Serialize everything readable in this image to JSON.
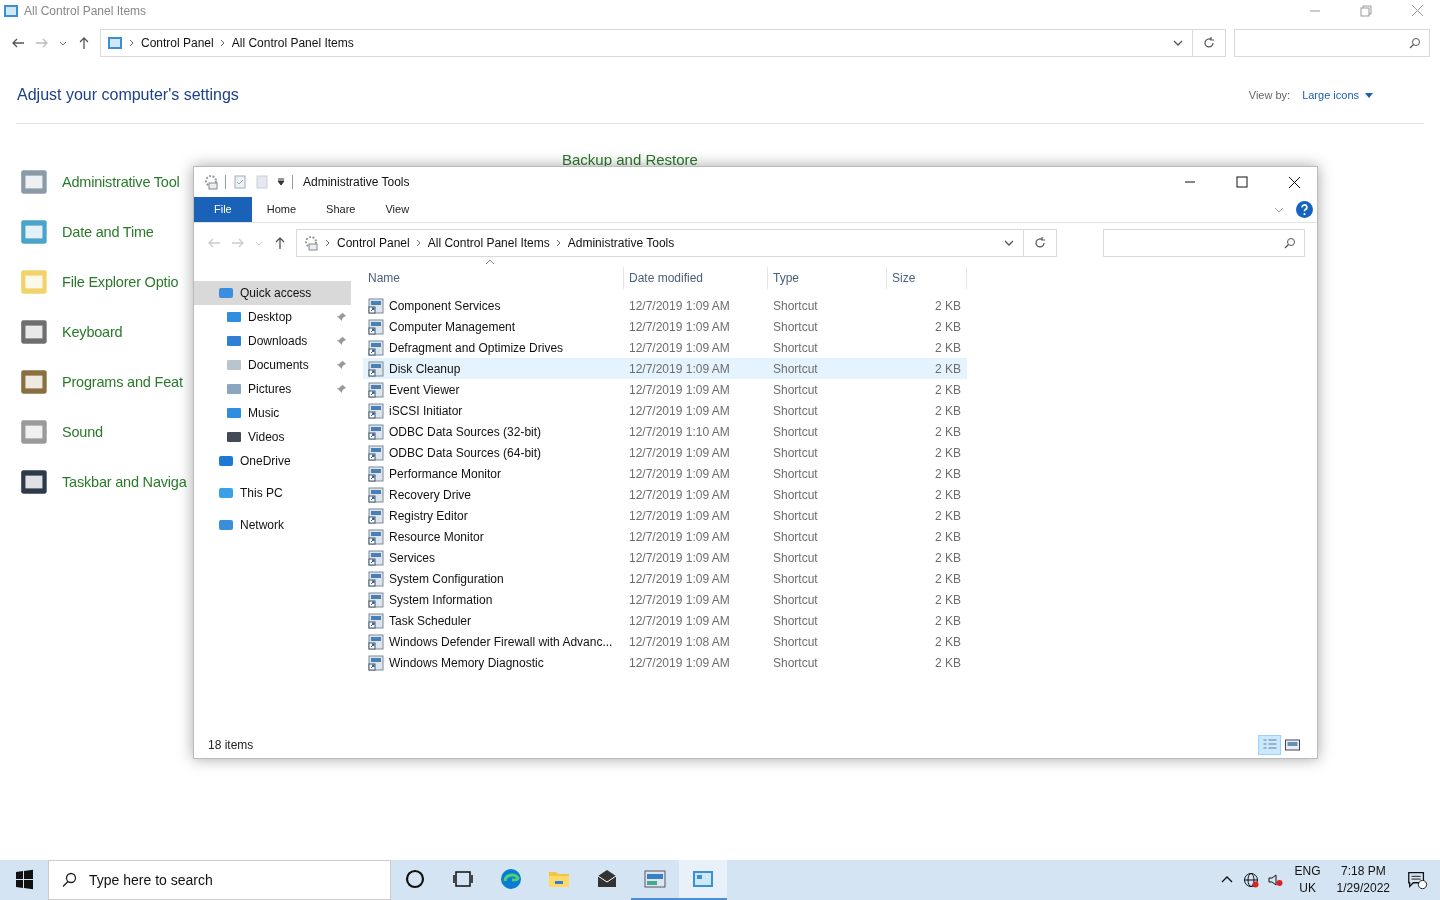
{
  "control_panel": {
    "title": "All Control Panel Items",
    "breadcrumb": [
      "Control Panel",
      "All Control Panel Items"
    ],
    "heading": "Adjust your computer's settings",
    "view_by": {
      "label": "View by:",
      "value": "Large icons"
    },
    "items": [
      {
        "label": "Administrative Tool",
        "kind": "admin"
      },
      {
        "label": "Date and Time",
        "kind": "clock"
      },
      {
        "label": "File Explorer Optio",
        "kind": "folder"
      },
      {
        "label": "Keyboard",
        "kind": "keyboard"
      },
      {
        "label": "Programs and Feat",
        "kind": "programs"
      },
      {
        "label": "Sound",
        "kind": "sound"
      },
      {
        "label": "Taskbar and Naviga",
        "kind": "taskbar"
      }
    ],
    "partial_item": "Backup and Restore"
  },
  "explorer": {
    "title": "Administrative Tools",
    "ribbon_tabs": [
      {
        "label": "File",
        "kind": "file"
      },
      {
        "label": "Home",
        "kind": "tab"
      },
      {
        "label": "Share",
        "kind": "tab"
      },
      {
        "label": "View",
        "kind": "tab"
      }
    ],
    "breadcrumb": [
      "Control Panel",
      "All Control Panel Items",
      "Administrative Tools"
    ],
    "nav": [
      {
        "label": "Quick access",
        "kind": "star",
        "selected": true,
        "children": [
          {
            "label": "Desktop",
            "kind": "desktop",
            "pinned": true,
            "selected": false
          },
          {
            "label": "Downloads",
            "kind": "download",
            "pinned": true,
            "selected": false
          },
          {
            "label": "Documents",
            "kind": "document",
            "pinned": true,
            "selected": false
          },
          {
            "label": "Pictures",
            "kind": "pictures",
            "pinned": true,
            "selected": false
          },
          {
            "label": "Music",
            "kind": "music",
            "pinned": false,
            "selected": false
          },
          {
            "label": "Videos",
            "kind": "videos",
            "pinned": false,
            "selected": false
          }
        ]
      },
      {
        "label": "OneDrive",
        "kind": "cloud",
        "selected": false
      },
      {
        "label": "This PC",
        "kind": "pc",
        "selected": false
      },
      {
        "label": "Network",
        "kind": "network",
        "selected": false
      }
    ],
    "columns": [
      "Name",
      "Date modified",
      "Type",
      "Size"
    ],
    "rows": [
      {
        "name": "Component Services",
        "date": "12/7/2019 1:09 AM",
        "type": "Shortcut",
        "size": "2 KB",
        "selected": false
      },
      {
        "name": "Computer Management",
        "date": "12/7/2019 1:09 AM",
        "type": "Shortcut",
        "size": "2 KB",
        "selected": false
      },
      {
        "name": "Defragment and Optimize Drives",
        "date": "12/7/2019 1:09 AM",
        "type": "Shortcut",
        "size": "2 KB",
        "selected": false
      },
      {
        "name": "Disk Cleanup",
        "date": "12/7/2019 1:09 AM",
        "type": "Shortcut",
        "size": "2 KB",
        "selected": true
      },
      {
        "name": "Event Viewer",
        "date": "12/7/2019 1:09 AM",
        "type": "Shortcut",
        "size": "2 KB",
        "selected": false
      },
      {
        "name": "iSCSI Initiator",
        "date": "12/7/2019 1:09 AM",
        "type": "Shortcut",
        "size": "2 KB",
        "selected": false
      },
      {
        "name": "ODBC Data Sources (32-bit)",
        "date": "12/7/2019 1:10 AM",
        "type": "Shortcut",
        "size": "2 KB",
        "selected": false
      },
      {
        "name": "ODBC Data Sources (64-bit)",
        "date": "12/7/2019 1:09 AM",
        "type": "Shortcut",
        "size": "2 KB",
        "selected": false
      },
      {
        "name": "Performance Monitor",
        "date": "12/7/2019 1:09 AM",
        "type": "Shortcut",
        "size": "2 KB",
        "selected": false
      },
      {
        "name": "Recovery Drive",
        "date": "12/7/2019 1:09 AM",
        "type": "Shortcut",
        "size": "2 KB",
        "selected": false
      },
      {
        "name": "Registry Editor",
        "date": "12/7/2019 1:09 AM",
        "type": "Shortcut",
        "size": "2 KB",
        "selected": false
      },
      {
        "name": "Resource Monitor",
        "date": "12/7/2019 1:09 AM",
        "type": "Shortcut",
        "size": "2 KB",
        "selected": false
      },
      {
        "name": "Services",
        "date": "12/7/2019 1:09 AM",
        "type": "Shortcut",
        "size": "2 KB",
        "selected": false
      },
      {
        "name": "System Configuration",
        "date": "12/7/2019 1:09 AM",
        "type": "Shortcut",
        "size": "2 KB",
        "selected": false
      },
      {
        "name": "System Information",
        "date": "12/7/2019 1:09 AM",
        "type": "Shortcut",
        "size": "2 KB",
        "selected": false
      },
      {
        "name": "Task Scheduler",
        "date": "12/7/2019 1:09 AM",
        "type": "Shortcut",
        "size": "2 KB",
        "selected": false
      },
      {
        "name": "Windows Defender Firewall with Advanc...",
        "date": "12/7/2019 1:08 AM",
        "type": "Shortcut",
        "size": "2 KB",
        "selected": false
      },
      {
        "name": "Windows Memory Diagnostic",
        "date": "12/7/2019 1:09 AM",
        "type": "Shortcut",
        "size": "2 KB",
        "selected": false
      }
    ],
    "status": "18 items"
  },
  "taskbar": {
    "search_placeholder": "Type here to search",
    "apps": [
      {
        "kind": "cortana",
        "running": false,
        "active": false
      },
      {
        "kind": "taskview",
        "running": false,
        "active": false
      },
      {
        "kind": "edge",
        "running": false,
        "active": false
      },
      {
        "kind": "folder",
        "running": false,
        "active": false
      },
      {
        "kind": "mail",
        "running": false,
        "active": false
      },
      {
        "kind": "admin",
        "running": true,
        "active": false
      },
      {
        "kind": "panel",
        "running": true,
        "active": true
      }
    ],
    "language": "ENG",
    "region": "UK",
    "time": "7:18 PM",
    "date": "1/29/2022"
  }
}
